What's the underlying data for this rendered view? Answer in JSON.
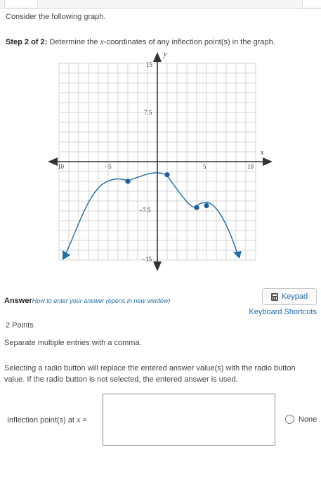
{
  "prompt": {
    "consider": "Consider the following graph.",
    "step_label": "Step 2 of 2:",
    "step_text_pre": "Determine the ",
    "step_var": "x",
    "step_text_post": "-coordinates of any inflection point(s) in the graph."
  },
  "graph": {
    "axis_x_label": "x",
    "axis_y_label": "y",
    "x_ticks": [
      "10",
      "−5",
      "5",
      "10"
    ],
    "y_ticks": [
      "15",
      "7.5",
      "−7.5",
      "−15"
    ],
    "curve_color": "#1f6ea8",
    "point_color": "#1f5e9a",
    "marked_points": [
      {
        "x": -3,
        "y": -3
      },
      {
        "x": 1,
        "y": -2
      },
      {
        "x": 4,
        "y": -7
      },
      {
        "x": 5,
        "y": -6.7
      }
    ]
  },
  "answer": {
    "label": "Answer",
    "howto": "How to enter your answer (opens in new window)",
    "keypad": "Keypad",
    "shortcuts": "Keyboard Shortcuts",
    "points": "2 Points",
    "separate": "Separate multiple entries with a comma.",
    "radio_note": "Selecting a radio button will replace the entered answer value(s) with the radio button value. If the radio button is not selected, the entered answer is used.",
    "ip_label_pre": "Inflection point(s) at ",
    "ip_var": "x",
    "ip_label_post": " =",
    "input_value": "",
    "none_label": "None"
  }
}
